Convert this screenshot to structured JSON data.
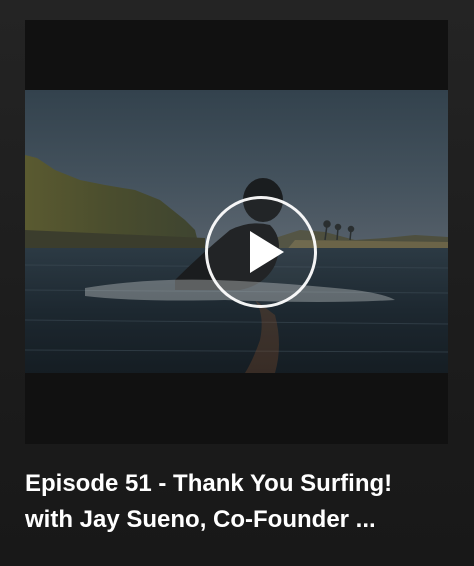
{
  "episode": {
    "title_line1": "Episode 51 - Thank You Surfing!",
    "title_line2": "with Jay Sueno, Co-Founder ..."
  },
  "media": {
    "thumbnail_icon": "video-thumbnail-surfer-at-dusk",
    "play_icon": "play-icon"
  },
  "colors": {
    "background": "#1c1c1c",
    "letterbox": "#111111",
    "title_text": "#ffffff"
  }
}
